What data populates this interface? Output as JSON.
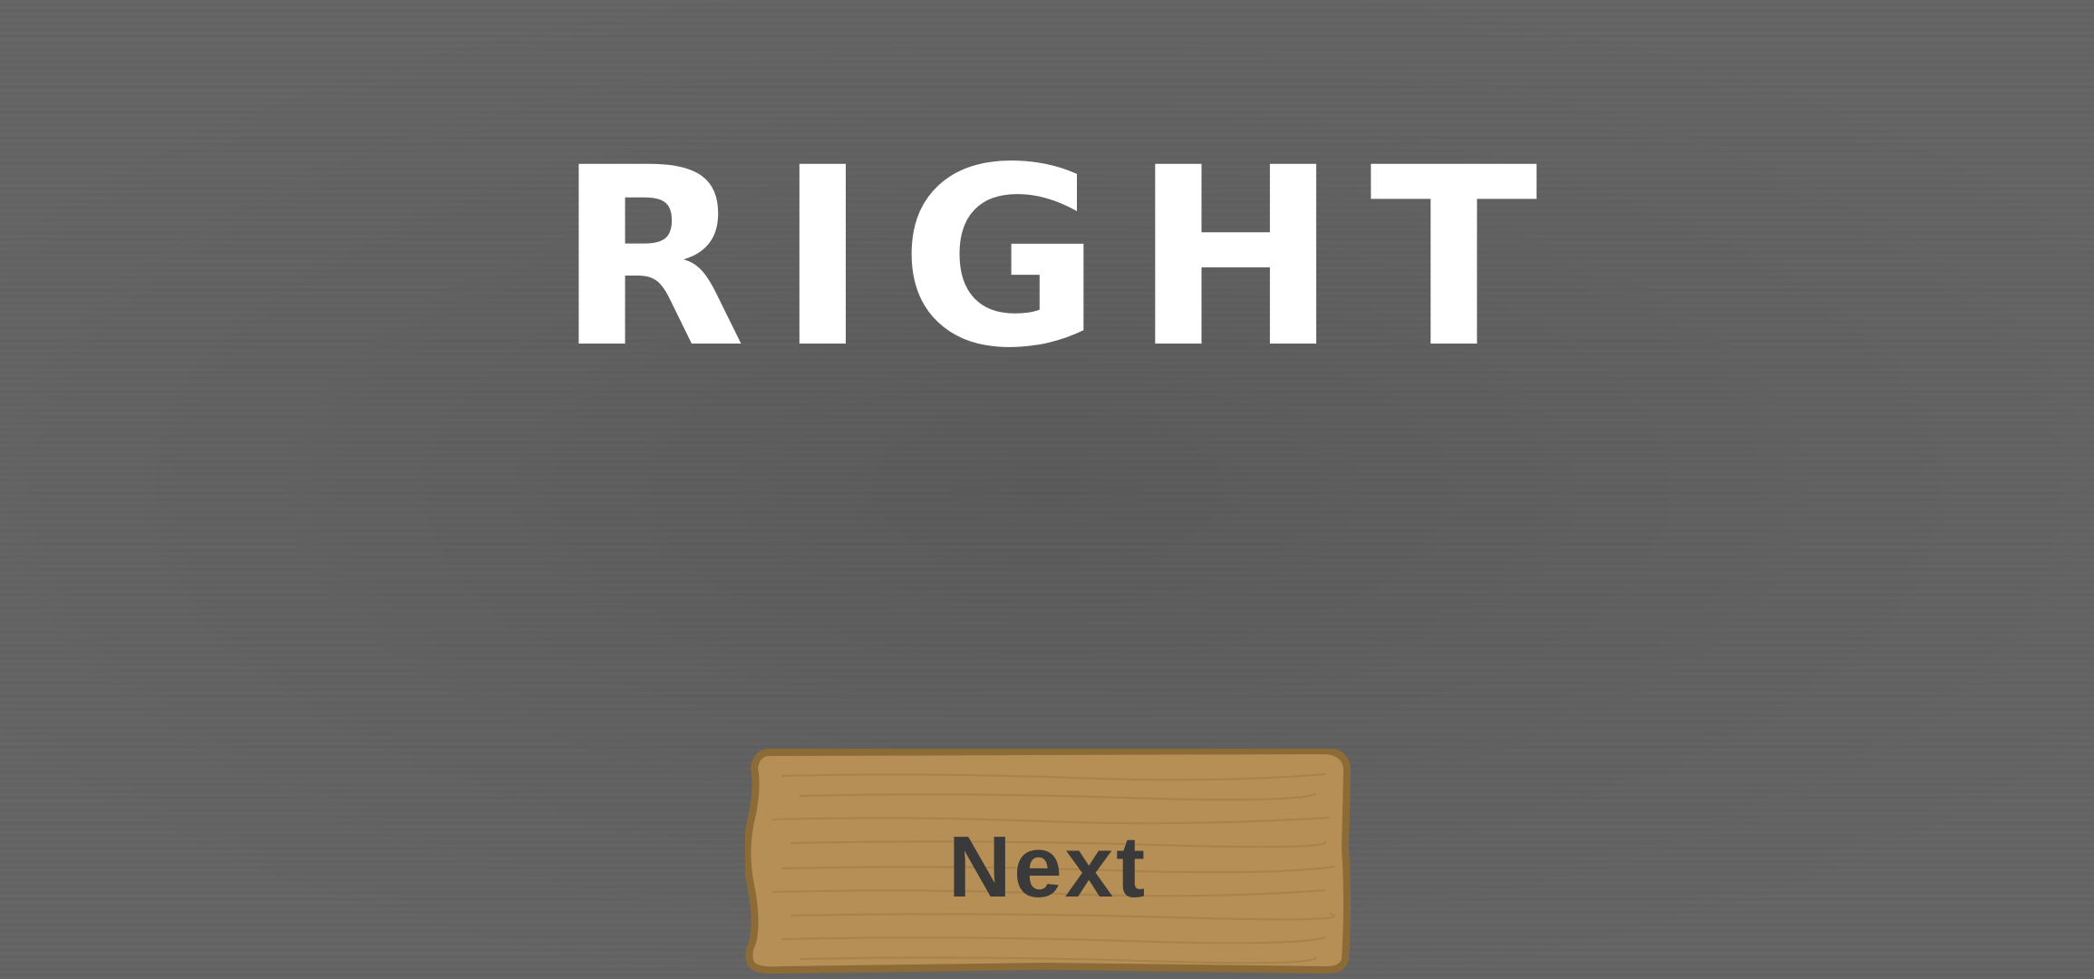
{
  "result": {
    "text": "RIGHT"
  },
  "next_button": {
    "label": "Next"
  },
  "colors": {
    "background": "#646464",
    "result_text": "#ffffff",
    "plank_fill": "#b58f55",
    "plank_border": "#8c6b36",
    "button_text": "#3a3a3a"
  }
}
